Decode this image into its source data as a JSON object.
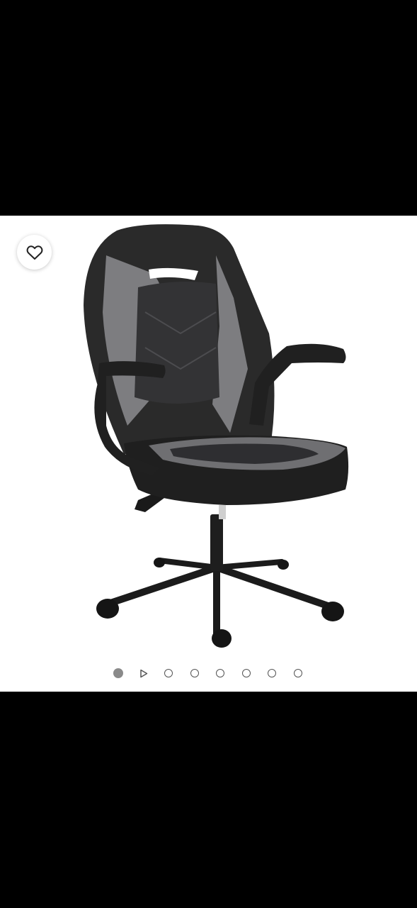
{
  "product_gallery": {
    "image": {
      "icon": "office-gaming-chair-image"
    },
    "favorite": {
      "icon": "heart-outline-icon"
    },
    "pagination": {
      "total_slides": 8,
      "active_index": 0,
      "video_slide_index": 1,
      "active_color": "#8a8a8a",
      "inactive_color": "#555555"
    }
  },
  "colors": {
    "frame_background": "#000000",
    "card_background": "#ffffff"
  }
}
